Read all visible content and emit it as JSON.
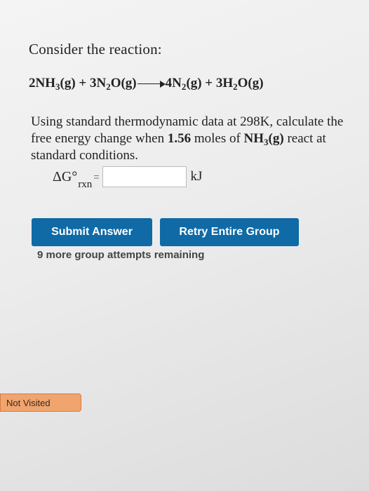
{
  "problem": {
    "intro": "Consider the reaction:",
    "equation": {
      "reactant1_coef": "2NH",
      "reactant1_sub": "3",
      "reactant1_state": "(g) + 3N",
      "reactant2_sub": "2",
      "reactant2_state": "O(g)",
      "product1_coef": "4N",
      "product1_sub": "2",
      "product1_state": "(g) + 3H",
      "product2_sub": "2",
      "product2_state": "O(g)"
    },
    "question_part1": "Using standard thermodynamic data at 298K, calculate the free energy change when ",
    "moles": "1.56",
    "question_part2": " moles of ",
    "species_main": "NH",
    "species_sub": "3",
    "species_state": "(g)",
    "question_part3": " react at standard conditions.",
    "answer_label_main": "ΔG°",
    "answer_label_sub": "rxn",
    "equals": "=",
    "answer_value": "",
    "unit": "kJ"
  },
  "buttons": {
    "submit_label": "Submit Answer",
    "retry_label": "Retry Entire Group"
  },
  "attempts_text": "9 more group attempts remaining",
  "status_badge": "Not Visited"
}
